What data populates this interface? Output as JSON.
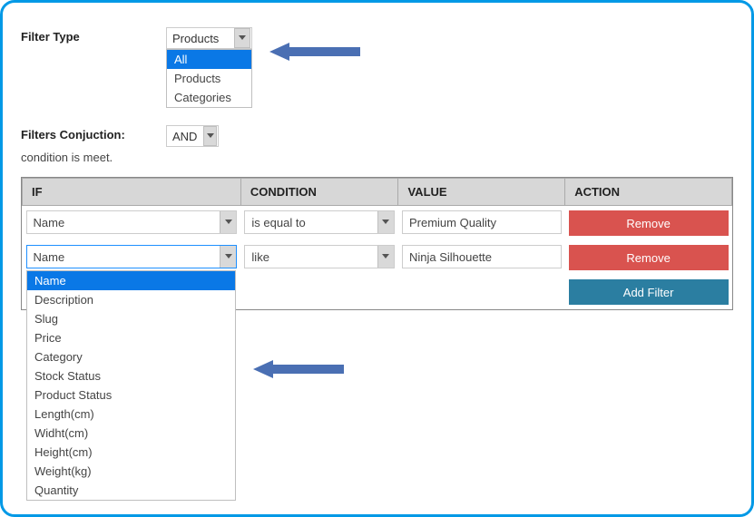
{
  "filterType": {
    "label": "Filter Type",
    "selected": "Products",
    "options": [
      "All",
      "Products",
      "Categories"
    ],
    "highlighted": "All"
  },
  "conjunction": {
    "label": "Filters Conjuction:",
    "selected": "AND",
    "hint": "condition is meet."
  },
  "headers": {
    "if": "IF",
    "condition": "CONDITION",
    "value": "VALUE",
    "action": "ACTION"
  },
  "rows": [
    {
      "if": "Name",
      "condition": "is equal to",
      "value": "Premium Quality",
      "action": "Remove"
    },
    {
      "if": "Name",
      "condition": "like",
      "value": "Ninja Silhouette",
      "action": "Remove"
    }
  ],
  "addFilter": "Add Filter",
  "ifOptions": {
    "highlighted": "Name",
    "list": [
      "Name",
      "Description",
      "Slug",
      "Price",
      "Category",
      "Stock Status",
      "Product Status",
      "Length(cm)",
      "Widht(cm)",
      "Height(cm)",
      "Weight(kg)",
      "Quantity"
    ]
  }
}
